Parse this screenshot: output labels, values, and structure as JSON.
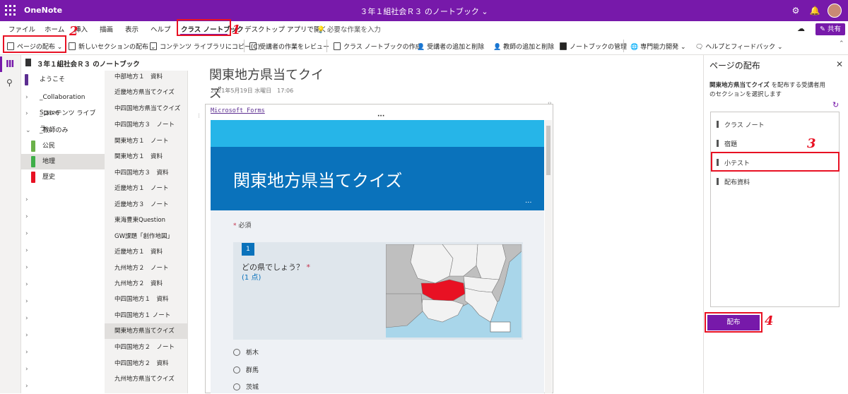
{
  "app": {
    "name": "OneNote",
    "notebook_title": "３年１組社会Ｒ３ のノートブック",
    "share_label": "共有"
  },
  "tabs": [
    "ファイル",
    "ホーム",
    "挿入",
    "描画",
    "表示",
    "ヘルプ",
    "クラス ノートブック",
    "デスクトップ アプリで開く"
  ],
  "tell_me": "必要な作業を入力",
  "commands": [
    "ページの配布",
    "新しいセクションの配布",
    "コンテンツ ライブラリにコピー(C)",
    "受講者の作業をレビュー",
    "クラス ノートブックの作成",
    "受講者の追加と削除",
    "教師の追加と削除",
    "ノートブックの管理",
    "専門能力開発",
    "ヘルプとフィードバック"
  ],
  "sidebar": {
    "notebook": "３年１組社会Ｒ３ のノートブック",
    "sections": [
      {
        "label": "ようこそ"
      },
      {
        "label": "_Collaboration Space"
      },
      {
        "label": "_コンテンツ ライブラ..."
      },
      {
        "label": "_教師のみ"
      },
      {
        "label": "公民",
        "color": "#6bb14a"
      },
      {
        "label": "地理",
        "color": "#3fae49"
      },
      {
        "label": "歴史",
        "color": "#e81123"
      }
    ],
    "pages": [
      "中部地方１　資料",
      "近畿地方県当てクイズ",
      "中四国地方県当てクイズ",
      "中四国地方３　ノート",
      "関東地方１　ノート",
      "関東地方１　資料",
      "中四国地方３　資料",
      "近畿地方１　ノート",
      "近畿地方３　ノート",
      "東海豊東Question",
      "GW課題「創作地図」",
      "近畿地方１　資料",
      "九州地方２　ノート",
      "九州地方２　資料",
      "中四国地方１　資料",
      "中四国地方１ ノート",
      "関東地方県当てクイズ",
      "中四国地方２　ノート",
      "中四国地方２　資料",
      "九州地方県当てクイズ"
    ]
  },
  "page": {
    "title": "関東地方県当てクイズ",
    "date": "2021年5月19日 水曜日　17:06",
    "forms_link": "Microsoft Forms"
  },
  "form": {
    "title": "関東地方県当てクイズ",
    "required_note": "必須",
    "q_number": "1",
    "q_text": "どの県でしょう？",
    "q_points": "(1 点)",
    "options": [
      "栃木",
      "群馬",
      "茨城"
    ]
  },
  "pane": {
    "title": "ページの配布",
    "desc_bold": "関東地方県当てクイズ",
    "desc_rest": " を配布する受講者用のセクションを選択します",
    "sections": [
      "クラス ノート",
      "宿題",
      "小テスト",
      "配布資料"
    ],
    "distribute_label": "配布"
  },
  "annotations": [
    "1",
    "2",
    "3",
    "4"
  ]
}
